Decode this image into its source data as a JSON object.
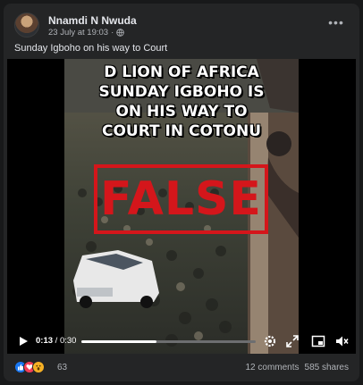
{
  "post": {
    "author": "Nnamdi N Nwuda",
    "date": "23 July at 19:03",
    "separator": "·",
    "privacy_icon": "globe-icon",
    "more_icon": "more-icon",
    "more_label": "•••",
    "text": "Sunday Igboho on his way to Court"
  },
  "video": {
    "caption_lines": [
      "D LION OF AFRICA",
      "SUNDAY IGBOHO IS",
      "ON HIS WAY TO",
      "COURT IN COTONU"
    ],
    "stamp_text": "FALSE",
    "stamp_color": "#d4161b",
    "current_time": "0:13",
    "duration": "0:30",
    "time_separator": "/",
    "progress": 0.433,
    "controls": [
      "play-icon",
      "settings-icon",
      "fullscreen-icon",
      "miniplayer-icon",
      "mute-icon"
    ]
  },
  "footer": {
    "reactions": [
      "like",
      "love",
      "wow"
    ],
    "reaction_count": "63",
    "comments": "12 comments",
    "shares": "585 shares"
  },
  "colors": {
    "background": "#18191a",
    "card": "#242526",
    "text_primary": "#e4e6eb",
    "text_secondary": "#b0b3b8",
    "like": "#1877f2"
  }
}
